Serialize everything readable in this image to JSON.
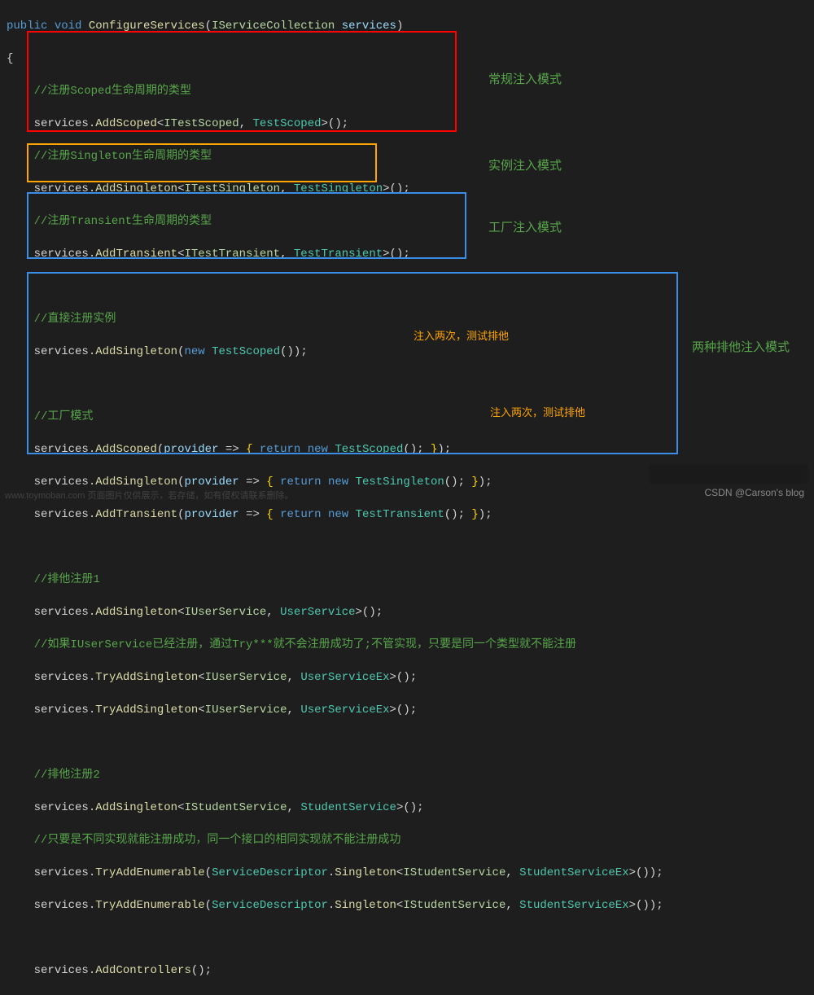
{
  "signature": {
    "public": "public",
    "void": "void",
    "name": "ConfigureServices",
    "paramType": "IServiceCollection",
    "paramName": "services"
  },
  "block1": {
    "c1": "//注册Scoped生命周期的类型",
    "l1_pre": "services.",
    "l1_m": "AddScoped",
    "l1_i": "ITestScoped",
    "l1_t": "TestScoped",
    "c2": "//注册Singleton生命周期的类型",
    "l2_pre": "services.",
    "l2_m": "AddSingleton",
    "l2_i": "ITestSingleton",
    "l2_t": "TestSingleton",
    "c3": "//注册Transient生命周期的类型",
    "l3_pre": "services.",
    "l3_m": "AddTransient",
    "l3_i": "ITestTransient",
    "l3_t": "TestTransient",
    "label": "常规注入模式"
  },
  "block2": {
    "c1": "//直接注册实例",
    "l1_pre": "services.",
    "l1_m": "AddSingleton",
    "l1_new": "new",
    "l1_t": "TestScoped",
    "label": "实例注入模式"
  },
  "block3": {
    "c1": "//工厂模式",
    "l1_pre": "services.",
    "l1_m": "AddScoped",
    "l1_p": "provider",
    "l1_ret": "return",
    "l1_new": "new",
    "l1_t": "TestScoped",
    "l2_pre": "services.",
    "l2_m": "AddSingleton",
    "l2_p": "provider",
    "l2_ret": "return",
    "l2_new": "new",
    "l2_t": "TestSingleton",
    "l3_pre": "services.",
    "l3_m": "AddTransient",
    "l3_p": "provider",
    "l3_ret": "return",
    "l3_new": "new",
    "l3_t": "TestTransient",
    "label": "工厂注入模式"
  },
  "block4": {
    "c1": "//排他注册1",
    "l1_pre": "services.",
    "l1_m": "AddSingleton",
    "l1_i": "IUserService",
    "l1_t": "UserService",
    "c2": "//如果IUserService已经注册，通过Try***就不会注册成功了;不管实现，只要是同一个类型就不能注册",
    "l2_pre": "services.",
    "l2_m": "TryAddSingleton",
    "l2_i": "IUserService",
    "l2_t": "UserServiceEx",
    "l3_pre": "services.",
    "l3_m": "TryAddSingleton",
    "l3_i": "IUserService",
    "l3_t": "UserServiceEx",
    "annot1": "注入两次，测试排他",
    "c3": "//排他注册2",
    "l4_pre": "services.",
    "l4_m": "AddSingleton",
    "l4_i": "IStudentService",
    "l4_t": "StudentService",
    "c4": "//只要是不同实现就能注册成功，同一个接口的相同实现就不能注册成功",
    "annot2": "注入两次，测试排他",
    "l5_pre": "services.",
    "l5_m": "TryAddEnumerable",
    "l5_sd": "ServiceDescriptor",
    "l5_sm": "Singleton",
    "l5_i": "IStudentService",
    "l5_t": "StudentServiceEx",
    "l6_pre": "services.",
    "l6_m": "TryAddEnumerable",
    "l6_sd": "ServiceDescriptor",
    "l6_sm": "Singleton",
    "l6_i": "IStudentService",
    "l6_t": "StudentServiceEx",
    "label": "两种排他注入模式"
  },
  "footer": {
    "l1_pre": "services.",
    "l1_m": "AddControllers"
  },
  "watermark": "CSDN @Carson's blog",
  "bottomline": "www.toymoban.com 页面图片仅供展示，若存储，如有侵权请联系删除。"
}
